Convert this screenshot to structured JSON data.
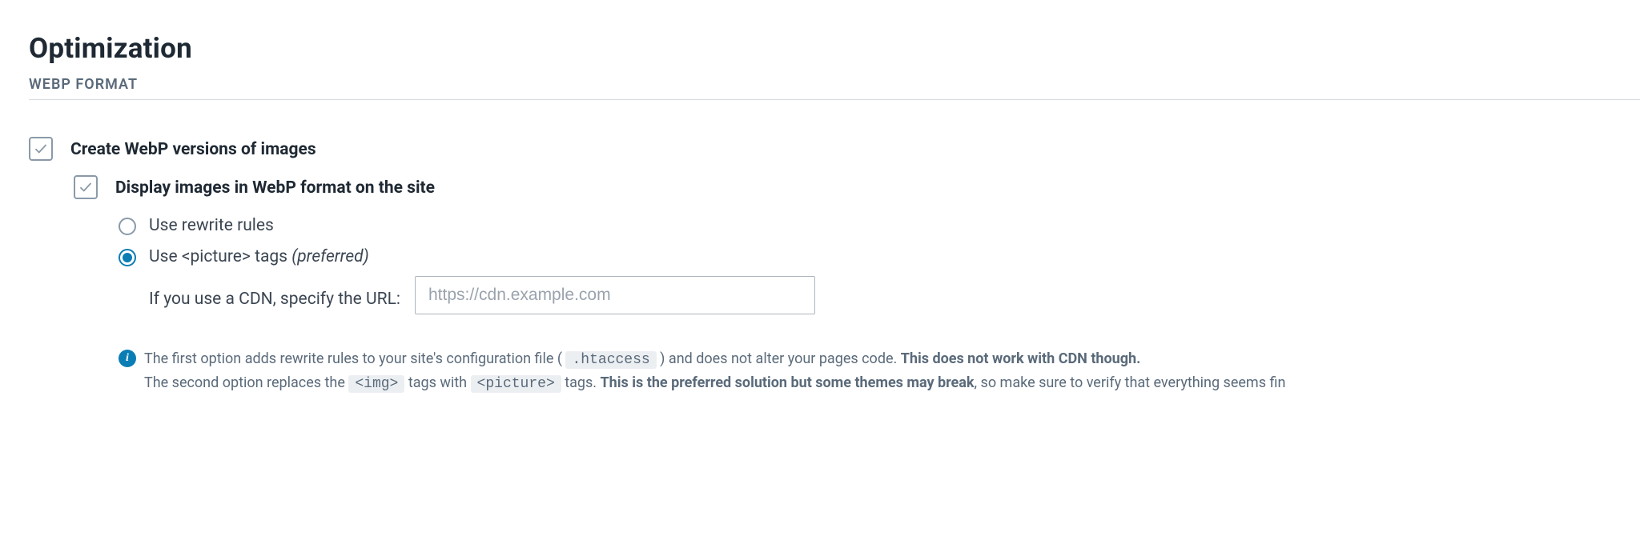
{
  "header": {
    "title": "Optimization",
    "section": "WEBP FORMAT"
  },
  "options": {
    "create_webp": {
      "label": "Create WebP versions of images",
      "checked": true
    },
    "display_webp": {
      "label": "Display images in WebP format on the site",
      "checked": true
    },
    "radios": {
      "rewrite": {
        "label": "Use rewrite rules",
        "selected": false
      },
      "picture": {
        "label_prefix": "Use ",
        "tag": "<picture>",
        "label_suffix": " tags ",
        "preferred": "(preferred)",
        "selected": true
      }
    },
    "cdn": {
      "label": "If you use a CDN, specify the URL:",
      "placeholder": "https://cdn.example.com",
      "value": ""
    }
  },
  "info": {
    "p1_a": "The first option adds rewrite rules to your site's configuration file ( ",
    "p1_code1": ".htaccess",
    "p1_b": " ) and does not alter your pages code. ",
    "p1_bold": "This does not work with CDN though.",
    "p2_a": "The second option replaces the ",
    "p2_code1": "<img>",
    "p2_b": " tags with ",
    "p2_code2": "<picture>",
    "p2_c": " tags. ",
    "p2_bold": "This is the preferred solution but some themes may break",
    "p2_d": ", so make sure to verify that everything seems fin"
  }
}
